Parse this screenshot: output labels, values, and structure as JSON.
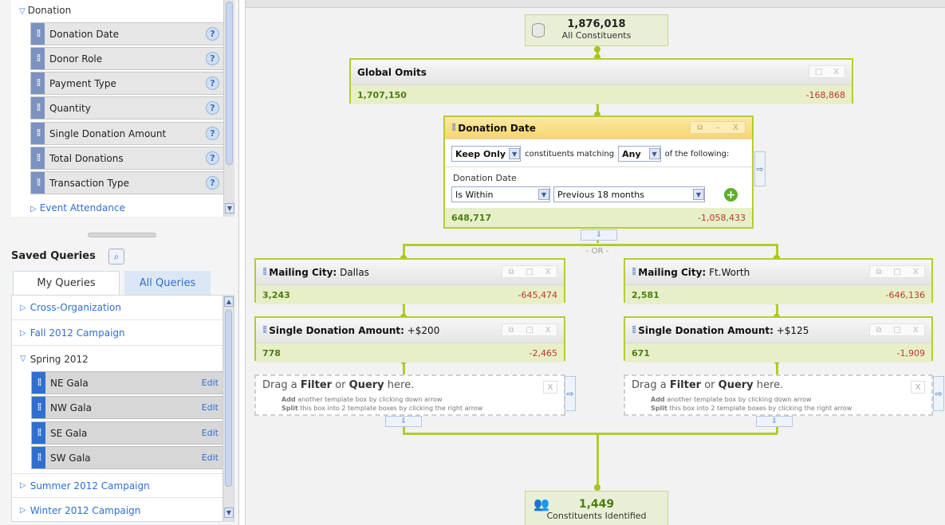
{
  "fields_panel": {
    "section_label": "Donation",
    "items": [
      {
        "label": "Donation Date"
      },
      {
        "label": "Donor Role"
      },
      {
        "label": "Payment Type"
      },
      {
        "label": "Quantity"
      },
      {
        "label": "Single Donation Amount"
      },
      {
        "label": "Total Donations"
      },
      {
        "label": "Transaction Type"
      }
    ],
    "next_section": "Event Attendance"
  },
  "saved_queries": {
    "title": "Saved Queries",
    "tabs": [
      "My Queries",
      "All Queries"
    ],
    "folders_top": [
      "Cross-Organization",
      "Fall 2012 Campaign"
    ],
    "open_folder": "Spring 2012",
    "items": [
      {
        "label": "NE Gala",
        "action": "Edit"
      },
      {
        "label": "NW Gala",
        "action": "Edit"
      },
      {
        "label": "SE Gala",
        "action": "Edit"
      },
      {
        "label": "SW Gala",
        "action": "Edit"
      }
    ],
    "folders_bottom": [
      "Summer 2012 Campaign",
      "Winter 2012 Campaign"
    ]
  },
  "canvas": {
    "start": {
      "count": "1,876,018",
      "label": "All Constituents"
    },
    "global_omits": {
      "title": "Global Omits",
      "kept": "1,707,150",
      "removed": "-168,868"
    },
    "donation_date": {
      "title": "Donation Date",
      "mode": "Keep Only",
      "text1": "constituents matching",
      "match": "Any",
      "text2": "of the following:",
      "field_label": "Donation Date",
      "operator": "Is Within",
      "value": "Previous 18 months",
      "kept": "648,717",
      "removed": "-1,058,433"
    },
    "or_label": "- OR -",
    "branches": [
      {
        "city_field": "Mailing City:",
        "city": "Dallas",
        "city_kept": "3,243",
        "city_removed": "-645,474",
        "amt_field": "Single Donation Amount:",
        "amt": "+$200",
        "amt_kept": "778",
        "amt_removed": "-2,465"
      },
      {
        "city_field": "Mailing City:",
        "city": "Ft.Worth",
        "city_kept": "2,581",
        "city_removed": "-646,136",
        "amt_field": "Single Donation Amount:",
        "amt": "+$125",
        "amt_kept": "671",
        "amt_removed": "-1,909"
      }
    ],
    "drop": {
      "prefix": "Drag a ",
      "filter": "Filter",
      "or": " or ",
      "query": "Query",
      "suffix": " here.",
      "add_bold": "Add",
      "add_rest": " another template box by clicking down arrow",
      "split_bold": "Split",
      "split_rest": " this box into 2 template boxes by clicking the right arrow"
    },
    "result": {
      "count": "1,449",
      "label": "Constituents Identified"
    }
  }
}
